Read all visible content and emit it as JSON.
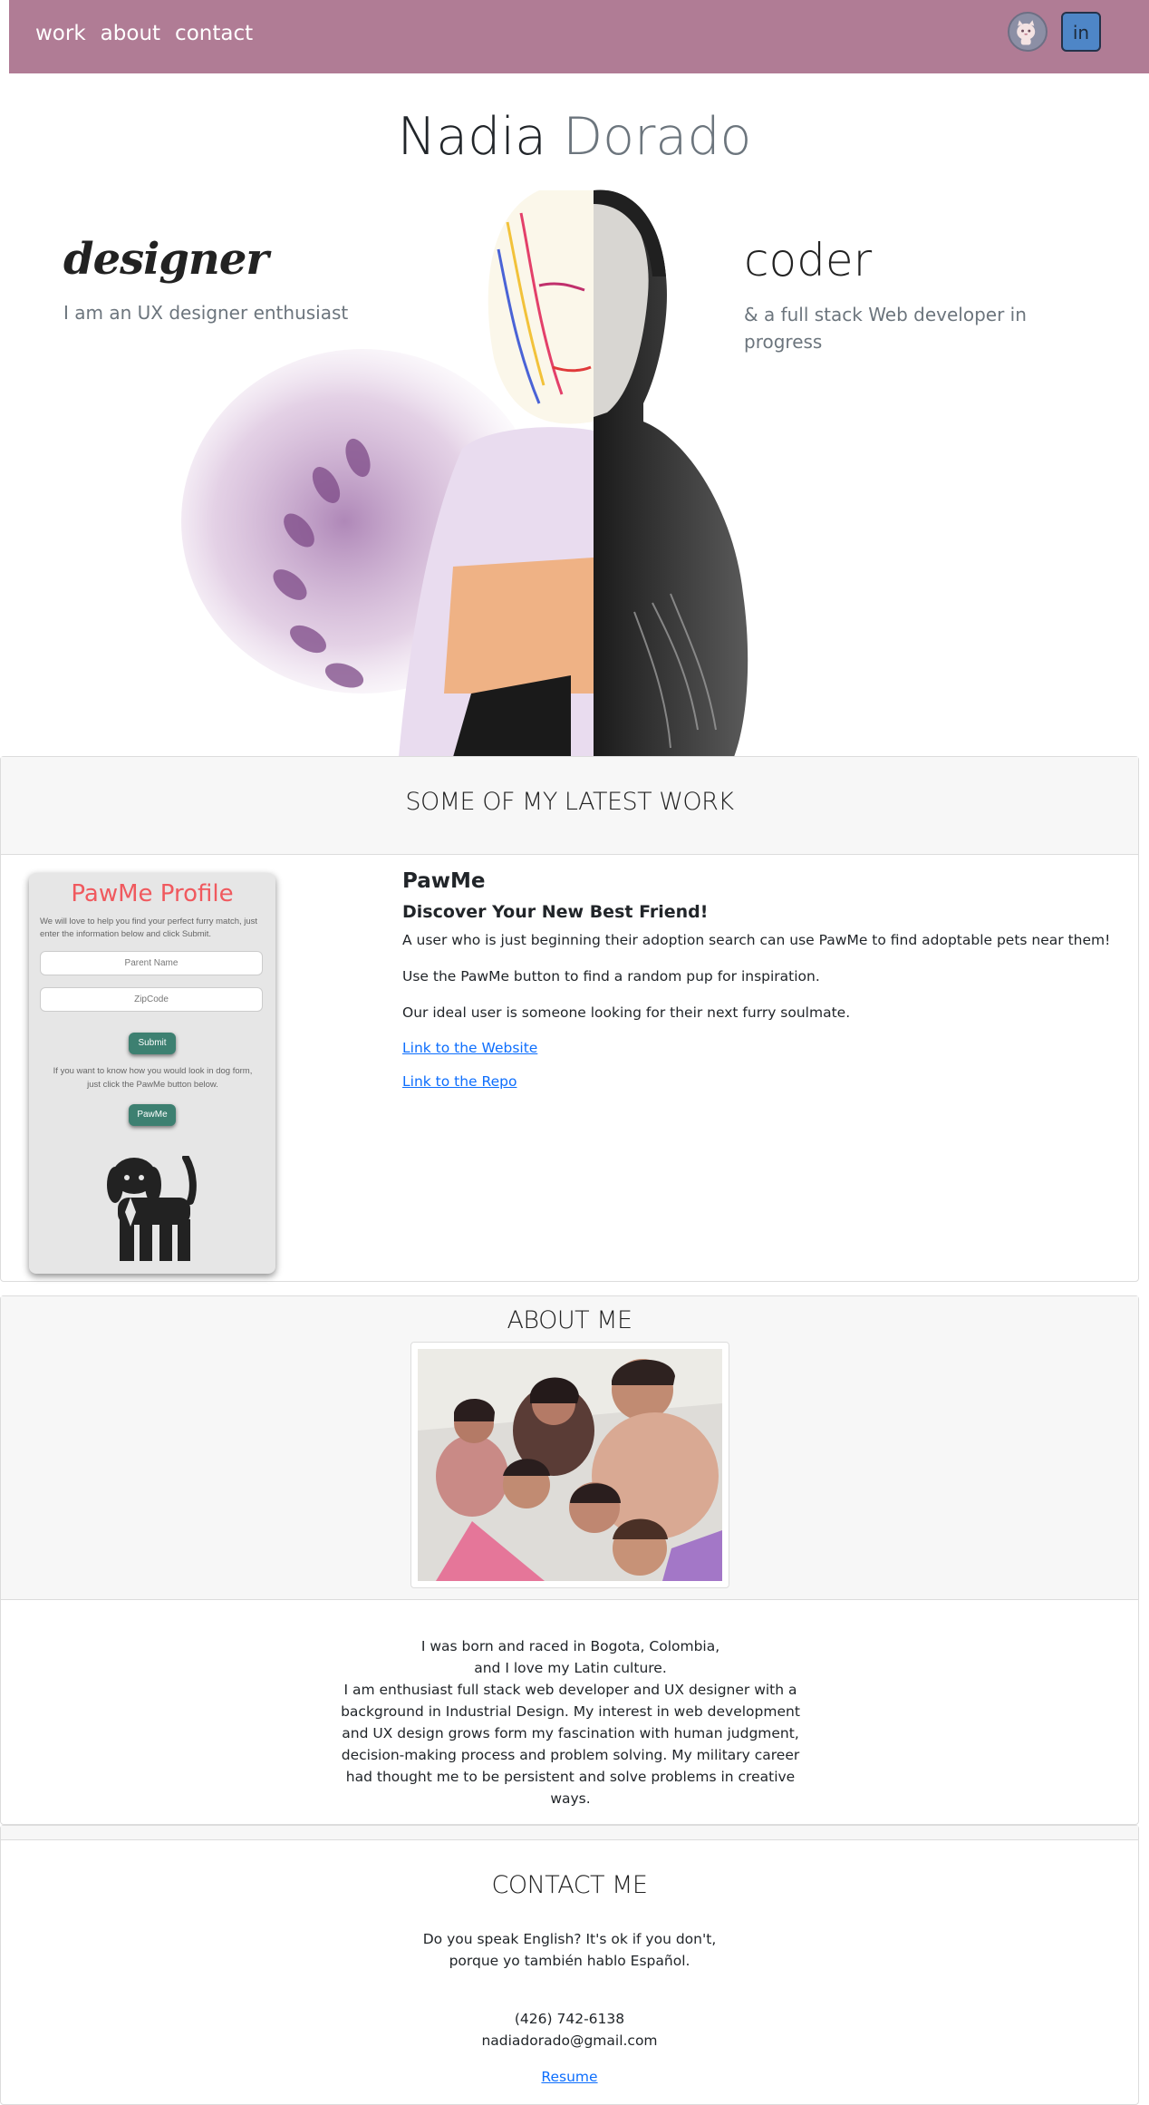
{
  "nav": {
    "links": [
      "work",
      "about",
      "contact"
    ],
    "github_icon": "github-octocat-icon",
    "linkedin_icon": "linkedin-icon",
    "linkedin_label": "in",
    "bar_color": "#b07c95"
  },
  "hero": {
    "first_name": "Nadia",
    "last_name": "Dorado",
    "left_title": "designer",
    "left_subtitle": "I am an UX designer enthusiast",
    "right_title": "coder",
    "right_subtitle": "& a full stack Web developer in progress"
  },
  "work": {
    "heading": "SOME OF MY LATEST WORK",
    "project": {
      "thumbnail": {
        "title": "PawMe Profile",
        "intro": "We will love to help you find your perfect furry match, just enter the information below and click Submit.",
        "parent_placeholder": "Parent Name",
        "zip_placeholder": "ZipCode",
        "submit_label": "Submit",
        "note": "If you want to know how you would look in dog form, just click the PawMe button below.",
        "pawme_label": "PawMe"
      },
      "name": "PawMe",
      "tagline": "Discover Your New Best Friend!",
      "paragraphs": [
        "A user who is just beginning their adoption search can use PawMe to find adoptable pets near them!",
        "Use the PawMe button to find a random pup for inspiration.",
        "Our ideal user is someone looking for their next furry soulmate."
      ],
      "website_link": "Link to the Website",
      "repo_link": "Link to the Repo"
    }
  },
  "about": {
    "heading": "ABOUT ME",
    "lines": [
      "I was born and raced in Bogota, Colombia,",
      "and I love my Latin culture."
    ],
    "paragraph": "I am enthusiast full stack web developer and UX designer with a background in Industrial Design. My interest in web development and UX design grows form my fascination with human judgment, decision-making process and problem solving. My military career had thought me to be persistent and solve problems in creative ways."
  },
  "contact": {
    "heading": "CONTACT ME",
    "lang_line1": "Do you speak English? It's ok if you don't,",
    "lang_line2": "porque yo también hablo Español.",
    "phone": "(426) 742-6138",
    "email": "nadiadorado@gmail.com",
    "resume_link": "Resume"
  }
}
